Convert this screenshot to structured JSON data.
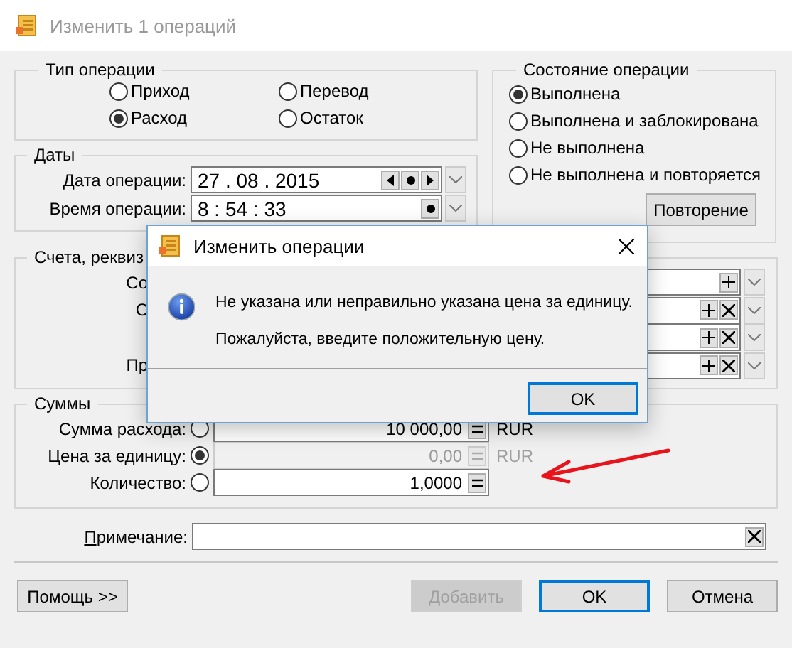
{
  "window": {
    "title": "Изменить 1 операций",
    "active": false
  },
  "operation_type": {
    "title": "Тип операции",
    "options": [
      {
        "label": "Приход",
        "selected": false
      },
      {
        "label": "Перевод",
        "selected": false
      },
      {
        "label": "Расход",
        "selected": true
      },
      {
        "label": "Остаток",
        "selected": false
      }
    ]
  },
  "dates": {
    "title": "Даты",
    "date": {
      "label": "Дата операции:",
      "value": "27 . 08 . 2015"
    },
    "time": {
      "label": "Время операции:",
      "value": "8 : 54 : 33"
    }
  },
  "status": {
    "title": "Состояние операции",
    "options": [
      {
        "label": "Выполнена",
        "selected": true
      },
      {
        "label": "Выполнена и заблокирована",
        "selected": false
      },
      {
        "label": "Не выполнена",
        "selected": false
      },
      {
        "label": "Не выполнена и повторяется",
        "selected": false
      }
    ],
    "button": "Повторение"
  },
  "accounts": {
    "title": "Счета, реквиз",
    "rows": [
      {
        "label": "Со",
        "removable": false
      },
      {
        "label": "С",
        "removable": true
      },
      {
        "removable": true
      },
      {
        "label": "Пр",
        "removable": true
      }
    ]
  },
  "sums": {
    "title": "Суммы",
    "rows": [
      {
        "label": "Сумма расхода:",
        "selected": false,
        "value": "10 000,00",
        "unit": "RUR",
        "disabled": false
      },
      {
        "label": "Цена за единицу:",
        "selected": true,
        "value": "0,00",
        "unit": "RUR",
        "disabled": true
      },
      {
        "label": "Количество:",
        "selected": false,
        "value": "1,0000",
        "disabled": false
      }
    ]
  },
  "note": {
    "label": "Примечание:"
  },
  "buttons": [
    {
      "label": "Помощь >>",
      "disabled": false,
      "default": false
    },
    {
      "label": "Добавить",
      "disabled": true,
      "default": false
    },
    {
      "label": "OK",
      "disabled": false,
      "default": true
    },
    {
      "label": "Отмена",
      "disabled": false,
      "default": false
    }
  ],
  "message_box": {
    "title": "Изменить операции",
    "kind": "info",
    "lines": [
      "Не указана или неправильно указана цена за единицу.",
      "Пожалуйста, введите положительную цену."
    ],
    "button": "OK"
  }
}
